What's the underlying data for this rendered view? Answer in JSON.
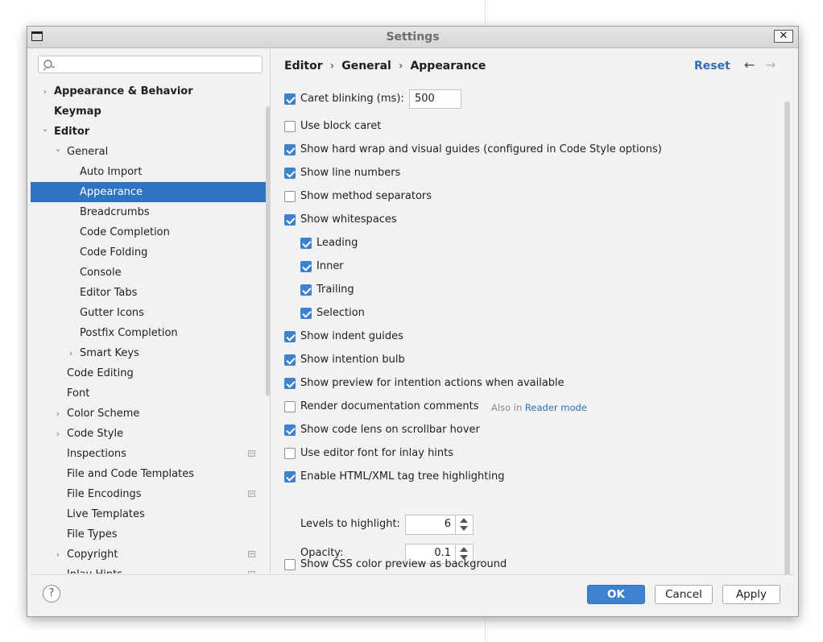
{
  "window": {
    "title": "Settings"
  },
  "search": {
    "placeholder": "",
    "value": ""
  },
  "tree": [
    {
      "label": "Appearance & Behavior",
      "bold": true,
      "indent": 0,
      "chevron": "right"
    },
    {
      "label": "Keymap",
      "bold": true,
      "indent": 0,
      "chevron": ""
    },
    {
      "label": "Editor",
      "bold": true,
      "indent": 0,
      "chevron": "down"
    },
    {
      "label": "General",
      "bold": false,
      "indent": 1,
      "chevron": "down"
    },
    {
      "label": "Auto Import",
      "bold": false,
      "indent": 2,
      "chevron": ""
    },
    {
      "label": "Appearance",
      "bold": false,
      "indent": 2,
      "chevron": "",
      "selected": true
    },
    {
      "label": "Breadcrumbs",
      "bold": false,
      "indent": 2,
      "chevron": ""
    },
    {
      "label": "Code Completion",
      "bold": false,
      "indent": 2,
      "chevron": ""
    },
    {
      "label": "Code Folding",
      "bold": false,
      "indent": 2,
      "chevron": ""
    },
    {
      "label": "Console",
      "bold": false,
      "indent": 2,
      "chevron": ""
    },
    {
      "label": "Editor Tabs",
      "bold": false,
      "indent": 2,
      "chevron": ""
    },
    {
      "label": "Gutter Icons",
      "bold": false,
      "indent": 2,
      "chevron": ""
    },
    {
      "label": "Postfix Completion",
      "bold": false,
      "indent": 2,
      "chevron": ""
    },
    {
      "label": "Smart Keys",
      "bold": false,
      "indent": 2,
      "chevron": "right"
    },
    {
      "label": "Code Editing",
      "bold": false,
      "indent": 1,
      "chevron": ""
    },
    {
      "label": "Font",
      "bold": false,
      "indent": 1,
      "chevron": ""
    },
    {
      "label": "Color Scheme",
      "bold": false,
      "indent": 1,
      "chevron": "right"
    },
    {
      "label": "Code Style",
      "bold": false,
      "indent": 1,
      "chevron": "right"
    },
    {
      "label": "Inspections",
      "bold": false,
      "indent": 1,
      "chevron": "",
      "project_icon": true
    },
    {
      "label": "File and Code Templates",
      "bold": false,
      "indent": 1,
      "chevron": ""
    },
    {
      "label": "File Encodings",
      "bold": false,
      "indent": 1,
      "chevron": "",
      "project_icon": true
    },
    {
      "label": "Live Templates",
      "bold": false,
      "indent": 1,
      "chevron": ""
    },
    {
      "label": "File Types",
      "bold": false,
      "indent": 1,
      "chevron": ""
    },
    {
      "label": "Copyright",
      "bold": false,
      "indent": 1,
      "chevron": "right",
      "project_icon": true
    },
    {
      "label": "Inlay Hints",
      "bold": false,
      "indent": 1,
      "chevron": "right",
      "project_icon": true
    }
  ],
  "breadcrumb": {
    "items": [
      "Editor",
      "General",
      "Appearance"
    ],
    "separator": "›"
  },
  "header": {
    "reset_label": "Reset",
    "back_icon": "←",
    "forward_icon": "→"
  },
  "options": {
    "caret_blinking": {
      "label": "Caret blinking (ms):",
      "checked": true,
      "value": "500"
    },
    "block_caret": {
      "label": "Use block caret",
      "checked": false
    },
    "hard_wrap": {
      "label": "Show hard wrap and visual guides (configured in Code Style options)",
      "checked": true
    },
    "line_numbers": {
      "label": "Show line numbers",
      "checked": true
    },
    "method_separators": {
      "label": "Show method separators",
      "checked": false
    },
    "whitespaces": {
      "label": "Show whitespaces",
      "checked": true
    },
    "leading": {
      "label": "Leading",
      "checked": true
    },
    "inner": {
      "label": "Inner",
      "checked": true
    },
    "trailing": {
      "label": "Trailing",
      "checked": true
    },
    "selection": {
      "label": "Selection",
      "checked": true
    },
    "indent_guides": {
      "label": "Show indent guides",
      "checked": true
    },
    "intention_bulb": {
      "label": "Show intention bulb",
      "checked": true
    },
    "preview_intention": {
      "label": "Show preview for intention actions when available",
      "checked": true
    },
    "render_docs": {
      "label": "Render documentation comments",
      "checked": false,
      "hint_prefix": "Also in",
      "hint_link": "Reader mode"
    },
    "code_lens": {
      "label": "Show code lens on scrollbar hover",
      "checked": true
    },
    "editor_font_inlay": {
      "label": "Use editor font for inlay hints",
      "checked": false
    },
    "tag_tree": {
      "label": "Enable HTML/XML tag tree highlighting",
      "checked": true
    },
    "levels": {
      "label": "Levels to highlight:",
      "value": "6"
    },
    "opacity": {
      "label": "Opacity:",
      "value": "0.1"
    },
    "css_color": {
      "label": "Show CSS color preview as background",
      "checked": false
    }
  },
  "footer": {
    "help_label": "?",
    "ok_label": "OK",
    "cancel_label": "Cancel",
    "apply_label": "Apply"
  },
  "colors": {
    "accent": "#3d81cf",
    "selection": "#2f74c0",
    "link": "#2f6eb5"
  }
}
